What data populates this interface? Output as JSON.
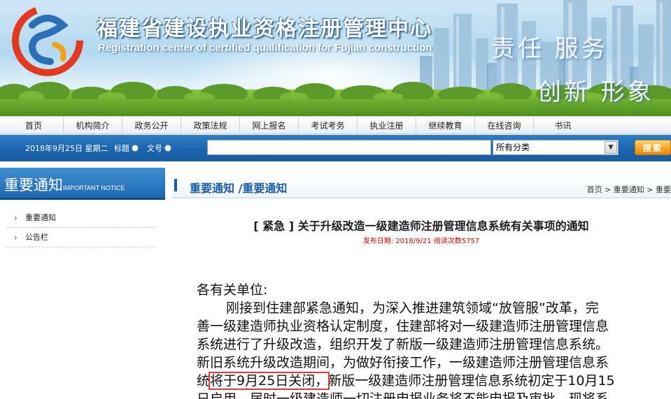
{
  "banner": {
    "title_cn": "福建省建设执业资格注册管理中心",
    "title_en": "Registration center of certified qualification for Fujian construction",
    "slogan_line1": "责任  服务",
    "slogan_line2": "创新  形象"
  },
  "nav": {
    "items": [
      "首页",
      "机构简介",
      "政务公开",
      "政策法规",
      "网上报名",
      "考试考务",
      "执业注册",
      "继续教育",
      "在线咨询",
      "书讯"
    ]
  },
  "search": {
    "date": "2018年9月25日 星期二",
    "opt_title": "标题",
    "opt_doc": "文号",
    "input_value": "",
    "category": "所有分类",
    "button": "搜索"
  },
  "sidebar": {
    "title": "重要通知",
    "title_en": "IMPORTANT NOTICE",
    "items": [
      "重要通知",
      "公告栏"
    ]
  },
  "main": {
    "section_title": "重要通知 /重要通知",
    "breadcrumb": "首页 > 重要通知 > 重要",
    "article_title": "[ 紧急 ] 关于升级改造一级建造师注册管理信息系统有关事项的通知",
    "meta": "发布日期: 2018/9/21   阅读次数5757",
    "salutation": "各有关单位:",
    "lines": [
      "刚接到住建部紧急通知，为深入推进建筑领域“放管服”改革，完",
      "善一级建造师执业资格认定制度，住建部将对一级建造师注册管理信息",
      "系统进行了升级改造，组织开发了新版一级建造师注册管理信息系统。",
      "新旧系统升级改造期间，为做好衔接工作，一级建造师注册管理信息系"
    ],
    "line5_prefix": "统",
    "line5_highlight": "将于9月25日关闭，",
    "line5_suffix": "新版一级建造师注册管理信息系统初定于10月15",
    "line6": "日启用。届时一级建造师一切注册申报业务将不能申报及审批。现将系"
  },
  "colors": {
    "nav_blue": "#1a5ea6",
    "highlight_red": "#e23a3a",
    "meta_red": "#cc0000",
    "search_orange": "#f6a623"
  }
}
